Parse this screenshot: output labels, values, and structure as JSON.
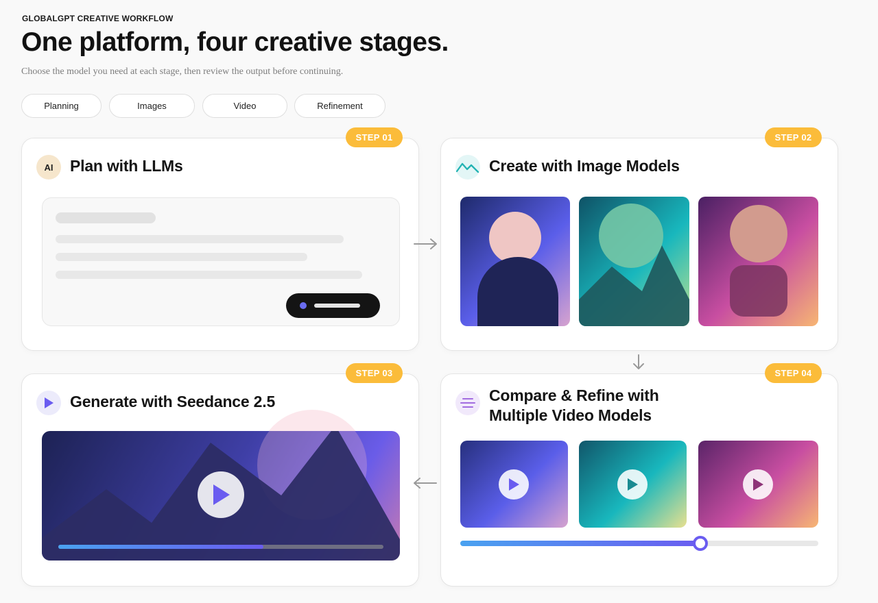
{
  "header": {
    "eyebrow": "GLOBALGPT CREATIVE WORKFLOW",
    "title": "One platform, four creative stages.",
    "subtitle": "Choose the model you need at each stage, then review the output before continuing."
  },
  "tabs": [
    {
      "label": "Planning"
    },
    {
      "label": "Images"
    },
    {
      "label": "Video"
    },
    {
      "label": "Refinement"
    }
  ],
  "steps": [
    {
      "badge": "STEP 01",
      "title": "Plan with LLMs",
      "icon_text": "AI",
      "icon": "ai-icon"
    },
    {
      "badge": "STEP 02",
      "title": "Create with Image Models",
      "icon": "mountain-line-icon"
    },
    {
      "badge": "STEP 03",
      "title": "Generate with Seedance 2.5",
      "icon": "play-icon"
    },
    {
      "badge": "STEP 04",
      "title_line1": "Compare & Refine with",
      "title_line2": "Multiple Video Models",
      "icon": "lines-icon"
    }
  ],
  "video_progress": 0.63,
  "compare_slider": 0.67,
  "colors": {
    "accent": "#fbbc3a",
    "primary_purple": "#6a5cf0",
    "teal": "#1fb3b8",
    "pink": "#d9559d"
  }
}
